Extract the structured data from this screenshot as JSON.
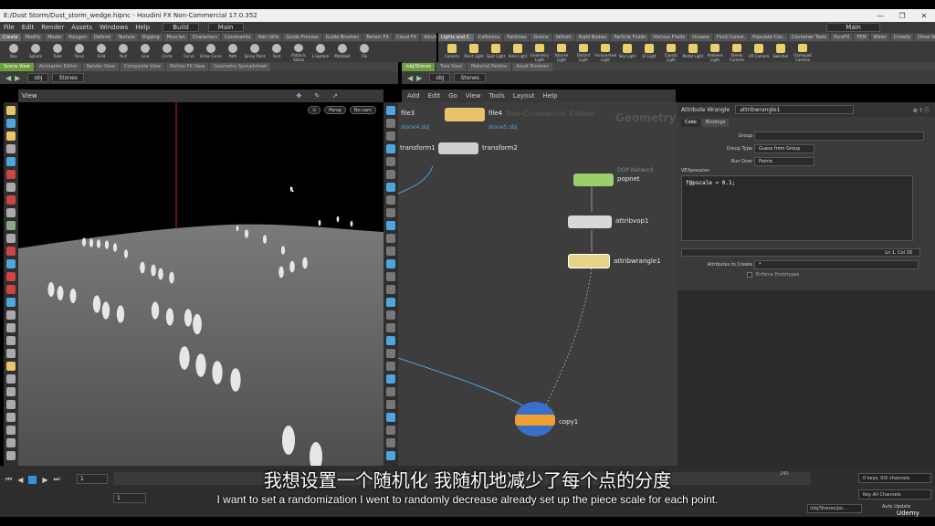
{
  "window": {
    "title": "E:/Dust Storm/Dust_storm_wedge.hipnc - Houdini FX Non-Commercial 17.0.352"
  },
  "menu": [
    "File",
    "Edit",
    "Render",
    "Assets",
    "Windows",
    "Help"
  ],
  "build_desktop": "Build",
  "main_desktop": "Main",
  "main_desktop_right": "Main",
  "shelf_tabs_left": [
    "Create",
    "Modify",
    "Model",
    "Polygon",
    "Deform",
    "Texture",
    "Rigging",
    "Muscles",
    "Characters",
    "Constraints",
    "Hair Utils",
    "Guide Process",
    "Guide Brushes",
    "Terrain FX",
    "Cloud FX",
    "Volume"
  ],
  "shelf_tabs_right": [
    "Lights and C.",
    "Collisions",
    "Particles",
    "Grains",
    "Vellum",
    "Rigid Bodies",
    "Particle Fluids",
    "Viscous Fluids",
    "Oceans",
    "Fluid Contai.",
    "Populate Con.",
    "Container Tools",
    "PyroFX",
    "FEM",
    "Wires",
    "Crowds",
    "Drive Simula."
  ],
  "shelf_tools_left": [
    "Box",
    "Sphere",
    "Tube",
    "Torus",
    "Grid",
    "Null",
    "Line",
    "Circle",
    "Curve",
    "Draw Curve",
    "Path",
    "Spray Paint",
    "Font",
    "Platonic Solids",
    "L-System",
    "Metaball",
    "File"
  ],
  "shelf_tools_right": [
    "Camera",
    "Point Light",
    "Spot Light",
    "Area Light",
    "Geometry Light",
    "Volume Light",
    "Distant Light",
    "Environment Light",
    "Sky Light",
    "GI Light",
    "Caustic Light",
    "Portal Light",
    "Ambient Light",
    "Stereo Camera",
    "VR Camera",
    "Switcher",
    "Gamepad Camera"
  ],
  "left_pane_tabs": [
    "Scene View",
    "Animation Editor",
    "Render View",
    "Composite View",
    "Motion FX View",
    "Geometry Spreadsheet"
  ],
  "right_pane_tabs": [
    "/obj/Stones",
    "Tree View",
    "Material Palette",
    "Asset Browser"
  ],
  "left_path": {
    "root": "obj",
    "node": "Stones"
  },
  "right_path": {
    "root": "obj",
    "node": "Stones"
  },
  "viewport": {
    "label": "View",
    "persp": "Persp",
    "cam": "No cam"
  },
  "network_menu": [
    "Add",
    "Edit",
    "Go",
    "View",
    "Tools",
    "Layout",
    "Help"
  ],
  "network_watermark": {
    "edition": "Non-Commercial Edition",
    "context": "Geometry"
  },
  "nodes": [
    {
      "name": "file3",
      "sub": "stone4.obj"
    },
    {
      "name": "file4",
      "sub": "stone5.obj"
    },
    {
      "name": "transform1",
      "sub": ""
    },
    {
      "name": "transform2",
      "sub": ""
    },
    {
      "name": "popnet",
      "sub": "DOP Network"
    },
    {
      "name": "attribvop1",
      "sub": ""
    },
    {
      "name": "attribwrangle1",
      "sub": ""
    },
    {
      "name": "copy1",
      "sub": ""
    }
  ],
  "params": {
    "node_type": "Attribute Wrangle",
    "node_name": "attribwrangle1",
    "tabs": [
      "Code",
      "Bindings"
    ],
    "group_label": "Group",
    "group_value": "",
    "group_type_label": "Group Type",
    "group_type_value": "Guess from Group",
    "run_over_label": "Run Over",
    "run_over_value": "Points",
    "vex_label": "VEXpression",
    "vex_code": "f@pscale = 0.1;",
    "cursor_pos": "Ln 1, Col 16",
    "attributes_label": "Attributes to Create",
    "attributes_value": "*",
    "enforce_label": "Enforce Prototypes"
  },
  "timeline": {
    "frame": "1",
    "start": "1",
    "end_marker": "240",
    "keys": "0 keys, 0/0 channels",
    "key_all": "Key All Channels",
    "obj_path": "/obj/Stones/po...",
    "auto_update": "Auto Update"
  },
  "subtitles": {
    "chinese": "我想设置一个随机化 我随机地减少了每个点的分度",
    "english": "I want to set a randomization I went to randomly decrease already set up the piece scale for each point."
  },
  "udemy": "Udemy",
  "colors": {
    "file_node": "#e8c56b",
    "transform_node": "#cfcfcf",
    "popnet_node": "#9ccf6b",
    "wrangle_node": "#e6d38a",
    "copy_node_ring": "#3a6fc9",
    "accent_blue": "#4ea5e0"
  }
}
